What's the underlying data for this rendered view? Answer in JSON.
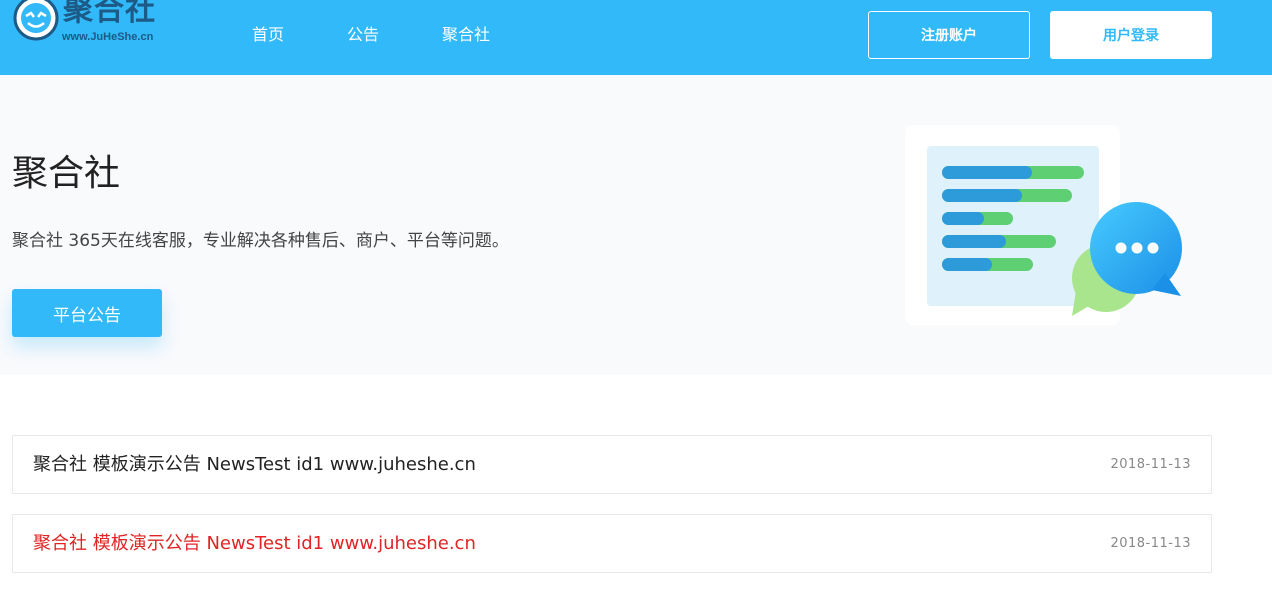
{
  "header": {
    "logo_text": "聚合社",
    "logo_sub": "www.JuHeShe.cn",
    "nav": [
      "首页",
      "公告",
      "聚合社"
    ],
    "register_label": "注册账户",
    "login_label": "用户登录"
  },
  "hero": {
    "title": "聚合社",
    "description": "聚合社 365天在线客服，专业解决各种售后、商户、平台等问题。",
    "button_label": "平台公告"
  },
  "notices": [
    {
      "title": "聚合社 模板演示公告 NewsTest id1 www.juheshe.cn",
      "date": "2018-11-13",
      "highlighted": false
    },
    {
      "title": "聚合社 模板演示公告 NewsTest id1 www.juheshe.cn",
      "date": "2018-11-13",
      "highlighted": true
    }
  ],
  "colors": {
    "brand": "#31b9fa",
    "hero_bg": "#f9fafc",
    "highlight_text": "#e02424",
    "bar_blue": "#2d9ad9",
    "bar_green": "#5fcf74"
  },
  "icons": [
    "logo-mark-icon",
    "chat-bubble-icon"
  ]
}
